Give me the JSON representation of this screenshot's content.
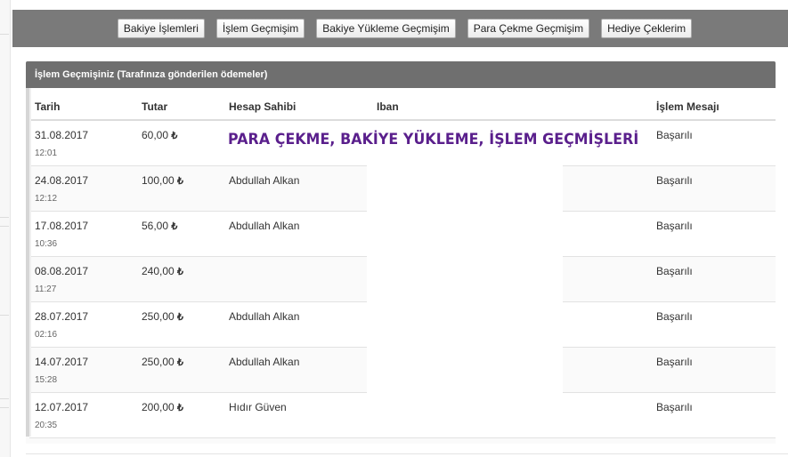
{
  "tabs": [
    {
      "label": "Bakiye İşlemleri"
    },
    {
      "label": "İşlem Geçmişim"
    },
    {
      "label": "Bakiye Yükleme Geçmişim"
    },
    {
      "label": "Para Çekme Geçmişim"
    },
    {
      "label": "Hediye Çeklerim"
    }
  ],
  "panel": {
    "title": "İşlem Geçmişiniz (Tarafınıza gönderilen ödemeler)"
  },
  "table": {
    "headers": {
      "date": "Tarih",
      "amount": "Tutar",
      "holder": "Hesap Sahibi",
      "iban": "Iban",
      "message": "İşlem Mesajı"
    },
    "rows": [
      {
        "date": "31.08.2017",
        "time": "12:01",
        "amount": "60,00",
        "currency": "₺",
        "holder": "",
        "iban": "",
        "message": "Başarılı"
      },
      {
        "date": "24.08.2017",
        "time": "12:12",
        "amount": "100,00",
        "currency": "₺",
        "holder": "Abdullah Alkan",
        "iban": "",
        "message": "Başarılı"
      },
      {
        "date": "17.08.2017",
        "time": "10:36",
        "amount": "56,00",
        "currency": "₺",
        "holder": "Abdullah Alkan",
        "iban": "",
        "message": "Başarılı"
      },
      {
        "date": "08.08.2017",
        "time": "11:27",
        "amount": "240,00",
        "currency": "₺",
        "holder": "",
        "iban": "",
        "message": "Başarılı"
      },
      {
        "date": "28.07.2017",
        "time": "02:16",
        "amount": "250,00",
        "currency": "₺",
        "holder": "Abdullah Alkan",
        "iban": "",
        "message": "Başarılı"
      },
      {
        "date": "14.07.2017",
        "time": "15:28",
        "amount": "250,00",
        "currency": "₺",
        "holder": "Abdullah Alkan",
        "iban": "",
        "message": "Başarılı"
      },
      {
        "date": "12.07.2017",
        "time": "20:35",
        "amount": "200,00",
        "currency": "₺",
        "holder": "Hıdır Güven",
        "iban": "",
        "message": "Başarılı"
      }
    ]
  },
  "overlay": {
    "title": "PARA ÇEKME, BAKİYE YÜKLEME, İŞLEM GEÇMİŞLERİ",
    "title_color": "#5a1f8c"
  }
}
